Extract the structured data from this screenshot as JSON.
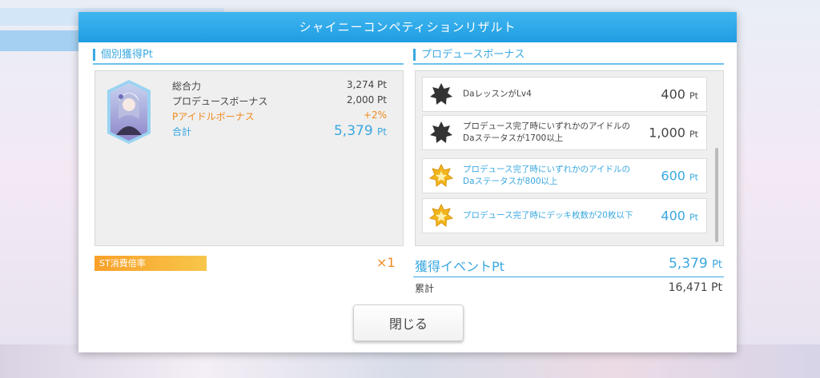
{
  "dialog": {
    "title": "シャイニーコンペティションリザルト",
    "individual": {
      "header": "個別獲得Pt",
      "rows": [
        {
          "label": "総合力",
          "value": "3,274 Pt"
        },
        {
          "label": "プロデュースボーナス",
          "value": "2,000 Pt"
        },
        {
          "label": "Pアイドルボーナス",
          "value": "+2%"
        }
      ],
      "total": {
        "label": "合計",
        "value": "5,379",
        "unit": "Pt"
      }
    },
    "produce_bonus": {
      "header": "プロデュースボーナス",
      "items": [
        {
          "text": "DaレッスンがLv4",
          "points": "400",
          "unit": "Pt",
          "achieved": false,
          "icon": "black-star-badge-icon"
        },
        {
          "text": "プロデュース完了時にいずれかのアイドルのDaステータスが1700以上",
          "points": "1,000",
          "unit": "Pt",
          "achieved": false,
          "icon": "black-star-badge-icon"
        },
        {
          "text": "プロデュース完了時にいずれかのアイドルのDaステータスが800以上",
          "points": "600",
          "unit": "Pt",
          "achieved": true,
          "icon": "gold-star-badge-icon"
        },
        {
          "text": "プロデュース完了時にデッキ枚数が20枚以下",
          "points": "400",
          "unit": "Pt",
          "achieved": true,
          "icon": "gold-star-badge-icon"
        }
      ]
    },
    "st_rate": {
      "label": "ST消費倍率",
      "multiplier": "×1"
    },
    "event_pt": {
      "label": "獲得イベントPt",
      "value": "5,379",
      "unit": "Pt"
    },
    "cumulative": {
      "label": "累計",
      "value": "16,471 Pt"
    },
    "close_label": "閉じる"
  },
  "colors": {
    "accent": "#3aa8e0",
    "orange": "#f08a1f",
    "title_bar": "#1f9de2"
  }
}
